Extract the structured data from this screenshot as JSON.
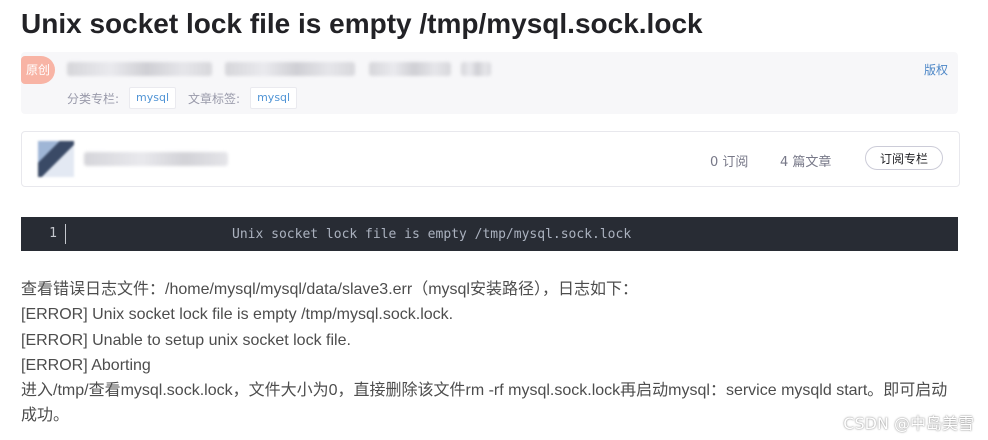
{
  "article": {
    "title": "Unix socket lock file is empty /tmp/mysql.sock.lock",
    "badge_original": "原创",
    "copyright_label": "版权",
    "category_label": "分类专栏:",
    "category_tag": "mysql",
    "tags_label": "文章标签:",
    "article_tag": "mysql"
  },
  "column": {
    "subscribers": "0 订阅",
    "articles": "4 篇文章",
    "subscribe_button": "订阅专栏"
  },
  "code": {
    "line_number": "1",
    "line_text": "Unix socket lock file is empty /tmp/mysql.sock.lock"
  },
  "body": {
    "lines": [
      "查看错误日志文件：/home/mysql/mysql/data/slave3.err（mysql安装路径），日志如下：",
      "[ERROR] Unix socket lock file is empty /tmp/mysql.sock.lock.",
      "[ERROR] Unable to setup unix socket lock file.",
      "[ERROR] Aborting",
      "进入/tmp/查看mysql.sock.lock，文件大小为0，直接删除该文件rm  -rf mysql.sock.lock再启动mysql：service mysqld start。即可启动成功。"
    ]
  },
  "watermark": "CSDN @中岛美雪"
}
